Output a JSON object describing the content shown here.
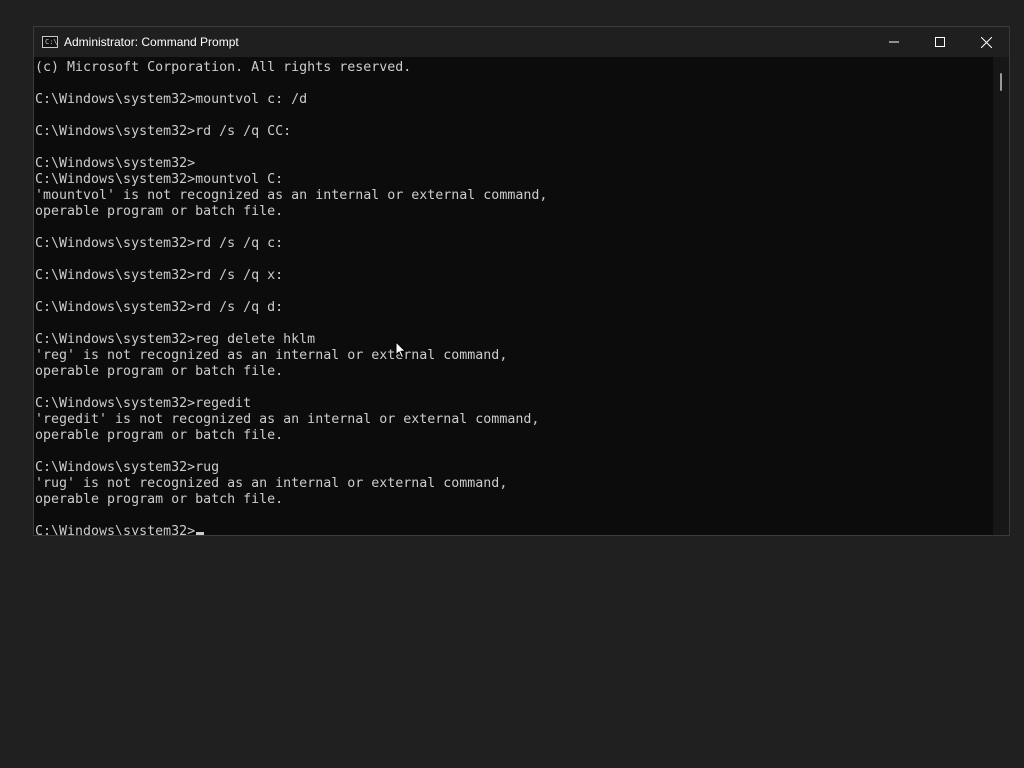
{
  "window": {
    "title": "Administrator: Command Prompt",
    "icon": "cmd-icon",
    "controls": {
      "minimize": "minimize-icon",
      "maximize": "maximize-icon",
      "close": "close-icon"
    }
  },
  "terminal": {
    "lines": [
      "(c) Microsoft Corporation. All rights reserved.",
      "",
      "C:\\Windows\\system32>mountvol c: /d",
      "",
      "C:\\Windows\\system32>rd /s /q CC:",
      "",
      "C:\\Windows\\system32>",
      "C:\\Windows\\system32>mountvol C:",
      "'mountvol' is not recognized as an internal or external command,",
      "operable program or batch file.",
      "",
      "C:\\Windows\\system32>rd /s /q c:",
      "",
      "C:\\Windows\\system32>rd /s /q x:",
      "",
      "C:\\Windows\\system32>rd /s /q d:",
      "",
      "C:\\Windows\\system32>reg delete hklm",
      "'reg' is not recognized as an internal or external command,",
      "operable program or batch file.",
      "",
      "C:\\Windows\\system32>regedit",
      "'regedit' is not recognized as an internal or external command,",
      "operable program or batch file.",
      "",
      "C:\\Windows\\system32>rug",
      "'rug' is not recognized as an internal or external command,",
      "operable program or batch file.",
      ""
    ],
    "prompt": "C:\\Windows\\system32>"
  },
  "colors": {
    "desktop": "#202020",
    "terminal_bg": "#0c0c0c",
    "terminal_fg": "#cccccc",
    "titlebar": "#1f1f1f"
  }
}
